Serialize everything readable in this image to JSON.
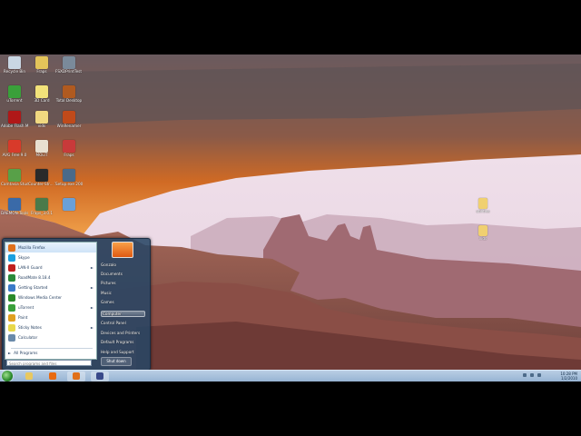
{
  "desktop": {
    "icons": [
      {
        "label": "Recycle Bin",
        "color": "#c9d6e3"
      },
      {
        "label": "Fraps",
        "color": "#e3c45a"
      },
      {
        "label": "FSXDPrintTest App",
        "color": "#7a8a9a"
      },
      {
        "label": "uTorrent",
        "color": "#3aa03a"
      },
      {
        "label": "3D Card",
        "color": "#f2e27a"
      },
      {
        "label": "Total Desktop",
        "color": "#b05a20"
      },
      {
        "label": "Adobe Flash Media Lo...",
        "color": "#b01818"
      },
      {
        "label": "vids",
        "color": "#f0d880"
      },
      {
        "label": "WinRenamer",
        "color": "#c04a1a"
      },
      {
        "label": "AVG Free 9.0",
        "color": "#d83a2a"
      },
      {
        "label": "MOLIT",
        "color": "#e8e0d0"
      },
      {
        "label": "Fraps",
        "color": "#c83a3a"
      },
      {
        "label": "Camtasia Studio 6",
        "color": "#58a048"
      },
      {
        "label": "Counter-Str... 1.6",
        "color": "#2a2a2a"
      },
      {
        "label": "Setup.exe 2009-12-0",
        "color": "#4a6a8a"
      },
      {
        "label": "DAEMON Tools Lite",
        "color": "#3a6aa8"
      },
      {
        "label": "Fraps_3.0.1",
        "color": "#4a7a4a"
      },
      {
        "label": "",
        "color": "#6aa0d8"
      }
    ],
    "right_icons": [
      {
        "label": "utilities",
        "color": "#f0d070"
      },
      {
        "label": "vids",
        "color": "#f0d070"
      }
    ]
  },
  "start_menu": {
    "programs": [
      {
        "label": "Mozilla Firefox",
        "color": "#e0701a",
        "arrow": ""
      },
      {
        "label": "Skype",
        "color": "#1aa0e0",
        "arrow": ""
      },
      {
        "label": "LAN-II Guard",
        "color": "#c02020",
        "arrow": "►"
      },
      {
        "label": "RoadMate 8.18.4",
        "color": "#2a8a3a",
        "arrow": ""
      },
      {
        "label": "Getting Started",
        "color": "#3a7ac8",
        "arrow": "►"
      },
      {
        "label": "Windows Media Center",
        "color": "#2a8a2a",
        "arrow": ""
      },
      {
        "label": "uTorrent",
        "color": "#3aa03a",
        "arrow": "►"
      },
      {
        "label": "Paint",
        "color": "#e0a020",
        "arrow": ""
      },
      {
        "label": "Sticky Notes",
        "color": "#e8d84a",
        "arrow": "►"
      },
      {
        "label": "Calculator",
        "color": "#6a8aaa",
        "arrow": ""
      }
    ],
    "all_programs": "All Programs",
    "search_placeholder": "Search programs and files",
    "right_links": [
      {
        "label": "Gonzalo"
      },
      {
        "label": "Documents"
      },
      {
        "label": "Pictures"
      },
      {
        "label": "Music"
      },
      {
        "label": "Games"
      },
      {
        "label": "Computer"
      },
      {
        "label": "Control Panel"
      },
      {
        "label": "Devices and Printers"
      },
      {
        "label": "Default Programs"
      },
      {
        "label": "Help and Support"
      }
    ],
    "shutdown_label": "Shut down"
  },
  "taskbar": {
    "clock_time": "10:28 PM",
    "clock_date": "1/2/2010",
    "pinned": [
      {
        "name": "explorer",
        "color": "#e8c860"
      },
      {
        "name": "media-player",
        "color": "#e86a10"
      },
      {
        "name": "firefox",
        "color": "#e0701a"
      },
      {
        "name": "camtasia",
        "color": "#3a4a8a"
      }
    ]
  }
}
